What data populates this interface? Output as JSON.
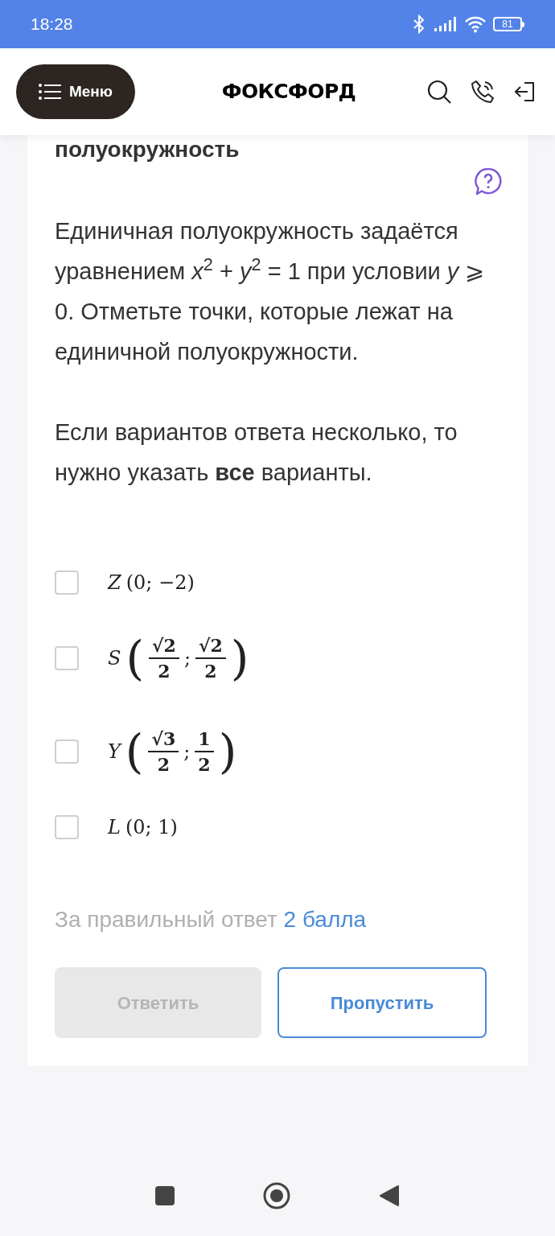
{
  "status_bar": {
    "time": "18:28",
    "battery": "81"
  },
  "header": {
    "menu_label": "Меню",
    "logo": "ФОКСФОРД"
  },
  "task": {
    "heading": "полуокружность",
    "paragraphs": [
      "Единичная полуокружность задаётся уравнением *x*$^{2}$ + *y*$^{2}$ = 1 при условии *y* ⩾ 0. Отметьте точки, которые лежат на единичной полуокружности.",
      "Если вариантов ответа несколько, то нужно указать **все** варианты."
    ],
    "options": [
      {
        "checked": false,
        "parts": [
          {
            "kind": "text",
            "text": "Z"
          },
          {
            "kind": "text",
            "text": "(0; −2)"
          }
        ]
      },
      {
        "checked": false,
        "parts": [
          {
            "kind": "text",
            "text": "S"
          },
          {
            "kind": "paren",
            "text": "("
          },
          {
            "kind": "frac",
            "num": "√2",
            "den": "2"
          },
          {
            "kind": "text",
            "text": ";"
          },
          {
            "kind": "frac",
            "num": "√2",
            "den": "2"
          },
          {
            "kind": "paren",
            "text": ")"
          }
        ]
      },
      {
        "checked": false,
        "parts": [
          {
            "kind": "text",
            "text": "Y"
          },
          {
            "kind": "paren",
            "text": "("
          },
          {
            "kind": "frac",
            "num": "√3",
            "den": "2"
          },
          {
            "kind": "text",
            "text": ";"
          },
          {
            "kind": "frac",
            "num": "1",
            "den": "2"
          },
          {
            "kind": "paren",
            "text": ")"
          }
        ]
      },
      {
        "checked": false,
        "parts": [
          {
            "kind": "text",
            "text": "L"
          },
          {
            "kind": "text",
            "text": "(0; 1)"
          }
        ]
      }
    ],
    "score_label": "За правильный ответ",
    "score_value": "2 балла",
    "buttons": [
      {
        "label": "Ответить",
        "disabled": true
      },
      {
        "label": "Пропустить",
        "disabled": false
      }
    ]
  }
}
